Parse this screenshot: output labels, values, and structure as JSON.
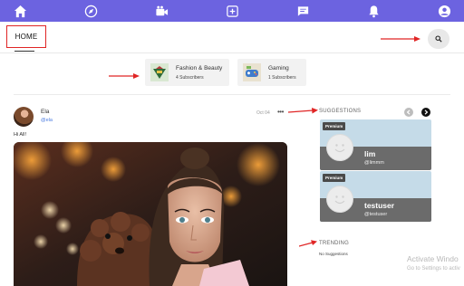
{
  "topnav": {
    "icons": [
      "home-icon",
      "compass-icon",
      "video-camera-icon",
      "add-post-icon",
      "message-icon",
      "bell-icon",
      "profile-icon"
    ],
    "bg_color": "#6c63e0"
  },
  "header": {
    "home_label": "HOME",
    "search_icon": "search-icon"
  },
  "categories": [
    {
      "name": "Fashion & Beauty",
      "subscribers": "4 Subscribers"
    },
    {
      "name": "Gaming",
      "subscribers": "1 Subscribers"
    }
  ],
  "post": {
    "author_name": "Ela",
    "author_handle": "@ela",
    "date": "Oct 04",
    "more": "•••",
    "text": "Hi All!"
  },
  "suggestions": {
    "title": "SUGGESTIONS",
    "items": [
      {
        "badge": "Premium",
        "name": "lim",
        "handle": "@limmm"
      },
      {
        "badge": "Premium",
        "name": "testuser",
        "handle": "@testuser"
      }
    ]
  },
  "trending": {
    "title": "TRENDING",
    "empty_text": "No Suggestions"
  },
  "watermark": {
    "line1": "Activate Windo",
    "line2": "Go to Settings to activ"
  },
  "annotation_color": "#e02525"
}
